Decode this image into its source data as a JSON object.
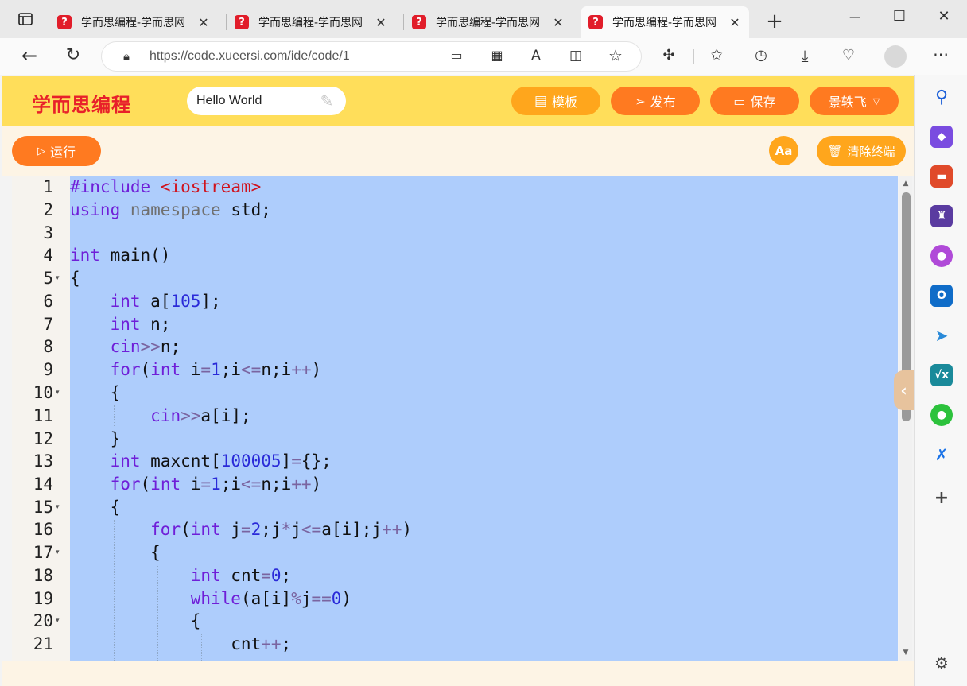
{
  "tabs": [
    {
      "title": "学而思编程-学而思网",
      "active": false
    },
    {
      "title": "学而思编程-学而思网",
      "active": false
    },
    {
      "title": "学而思编程-学而思网",
      "active": false
    },
    {
      "title": "学而思编程-学而思网",
      "active": true
    }
  ],
  "window_controls": {
    "minimize": "—",
    "maximize": "☐",
    "close": "✕"
  },
  "address_bar": {
    "url": "https://code.xueersi.com/ide/code/1"
  },
  "page": {
    "logo": "学而思编程",
    "project_title": "Hello World",
    "buttons": {
      "template": "模板",
      "publish": "发布",
      "save": "保存",
      "user": "景轶飞"
    },
    "toolbar": {
      "run": "运行",
      "font": "Aa",
      "clear": "清除终端"
    }
  },
  "editor": {
    "line_numbers": [
      "1",
      "2",
      "3",
      "4",
      "5",
      "6",
      "7",
      "8",
      "9",
      "10",
      "11",
      "12",
      "13",
      "14",
      "15",
      "16",
      "17",
      "18",
      "19",
      "20",
      "21"
    ],
    "fold_lines": [
      5,
      10,
      15,
      17,
      20
    ],
    "selection_color": "#aecdfc"
  },
  "colors": {
    "header": "#ffde5a",
    "accent": "#ff7a20",
    "keyword": "#6f1fd8",
    "number": "#2a2ad8",
    "include_string": "#d0121c"
  }
}
